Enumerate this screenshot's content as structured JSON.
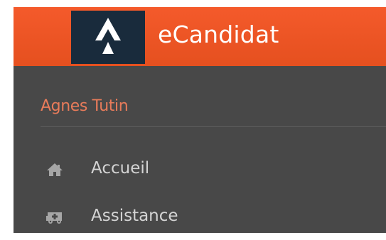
{
  "app": {
    "title": "eCandidat",
    "logo_icon": "ecandidat-logo-icon"
  },
  "user": {
    "name": "Agnes Tutin"
  },
  "menu": {
    "items": [
      {
        "label": "Accueil",
        "icon": "home-icon"
      },
      {
        "label": "Assistance",
        "icon": "ambulance-icon"
      }
    ]
  },
  "colors": {
    "header": "#f45a2b",
    "sidebar": "#484848",
    "logo_box": "#192b3c",
    "user_name": "#e87b5a",
    "menu_text": "#d4d4d4",
    "icon": "#a6a6a6"
  }
}
